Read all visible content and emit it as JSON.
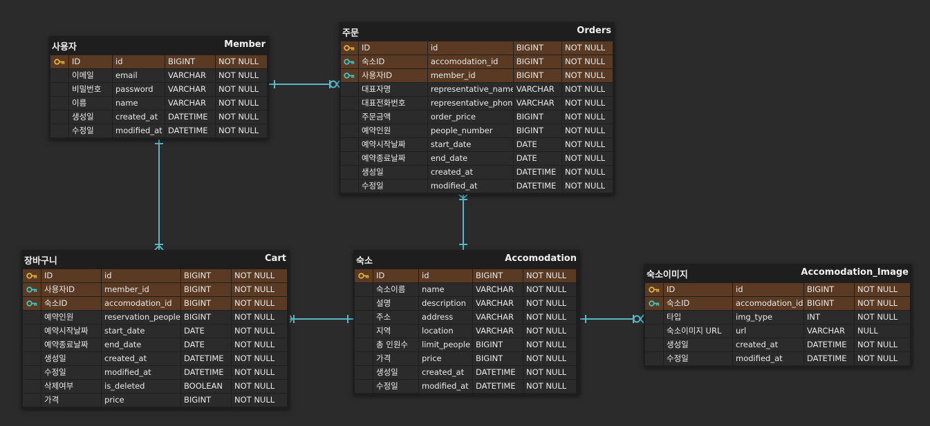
{
  "colors": {
    "background": "#2b2b2b",
    "table": "#1e1e1e",
    "cell": "#2b2b2b",
    "key_row": "#5a3a22",
    "primary_key_icon": "#e0b43c",
    "foreign_key_icon": "#3fc8c8",
    "relation_line": "#5ab8c8"
  },
  "tables": {
    "member": {
      "title_ko": "사용자",
      "title_en": "Member",
      "rows": [
        {
          "icon": "pk",
          "label": "ID",
          "name": "id",
          "type": "BIGINT",
          "constraint": "NOT NULL"
        },
        {
          "icon": "",
          "label": "이메일",
          "name": "email",
          "type": "VARCHAR",
          "constraint": "NOT NULL"
        },
        {
          "icon": "",
          "label": "비밀번호",
          "name": "password",
          "type": "VARCHAR",
          "constraint": "NOT NULL"
        },
        {
          "icon": "",
          "label": "이름",
          "name": "name",
          "type": "VARCHAR",
          "constraint": "NOT NULL"
        },
        {
          "icon": "",
          "label": "생성일",
          "name": "created_at",
          "type": "DATETIME",
          "constraint": "NOT NULL"
        },
        {
          "icon": "",
          "label": "수정일",
          "name": "modified_at",
          "type": "DATETIME",
          "constraint": "NOT NULL"
        }
      ]
    },
    "orders": {
      "title_ko": "주문",
      "title_en": "Orders",
      "rows": [
        {
          "icon": "pk",
          "label": "ID",
          "name": "id",
          "type": "BIGINT",
          "constraint": "NOT NULL"
        },
        {
          "icon": "fk",
          "label": "숙소ID",
          "name": "accomodation_id",
          "type": "BIGINT",
          "constraint": "NOT NULL"
        },
        {
          "icon": "fk",
          "label": "사용자ID",
          "name": "member_id",
          "type": "BIGINT",
          "constraint": "NOT NULL"
        },
        {
          "icon": "",
          "label": "대표자명",
          "name": "representative_name",
          "type": "VARCHAR",
          "constraint": "NOT NULL"
        },
        {
          "icon": "",
          "label": "대표전화번호",
          "name": "representative_phone",
          "type": "VARCHAR",
          "constraint": "NOT NULL"
        },
        {
          "icon": "",
          "label": "주문금액",
          "name": "order_price",
          "type": "BIGINT",
          "constraint": "NOT NULL"
        },
        {
          "icon": "",
          "label": "예약인원",
          "name": "people_number",
          "type": "BIGINT",
          "constraint": "NOT NULL"
        },
        {
          "icon": "",
          "label": "예약시작날짜",
          "name": "start_date",
          "type": "DATE",
          "constraint": "NOT NULL"
        },
        {
          "icon": "",
          "label": "예약종료날짜",
          "name": "end_date",
          "type": "DATE",
          "constraint": "NOT NULL"
        },
        {
          "icon": "",
          "label": "생성일",
          "name": "created_at",
          "type": "DATETIME",
          "constraint": "NOT NULL"
        },
        {
          "icon": "",
          "label": "수정일",
          "name": "modified_at",
          "type": "DATETIME",
          "constraint": "NOT NULL"
        }
      ]
    },
    "cart": {
      "title_ko": "장바구니",
      "title_en": "Cart",
      "rows": [
        {
          "icon": "pk",
          "label": "ID",
          "name": "id",
          "type": "BIGINT",
          "constraint": "NOT NULL"
        },
        {
          "icon": "fk",
          "label": "사용자ID",
          "name": "member_id",
          "type": "BIGINT",
          "constraint": "NOT NULL"
        },
        {
          "icon": "fk",
          "label": "숙소ID",
          "name": "accomodation_id",
          "type": "BIGINT",
          "constraint": "NOT NULL"
        },
        {
          "icon": "",
          "label": "예약인원",
          "name": "reservation_people",
          "type": "BIGINT",
          "constraint": "NOT NULL"
        },
        {
          "icon": "",
          "label": "예약시작날짜",
          "name": "start_date",
          "type": "DATE",
          "constraint": "NOT NULL"
        },
        {
          "icon": "",
          "label": "예약종료날짜",
          "name": "end_date",
          "type": "DATE",
          "constraint": "NOT NULL"
        },
        {
          "icon": "",
          "label": "생성일",
          "name": "created_at",
          "type": "DATETIME",
          "constraint": "NOT NULL"
        },
        {
          "icon": "",
          "label": "수정일",
          "name": "modified_at",
          "type": "DATETIME",
          "constraint": "NOT NULL"
        },
        {
          "icon": "",
          "label": "삭제여부",
          "name": "is_deleted",
          "type": "BOOLEAN",
          "constraint": "NOT NULL"
        },
        {
          "icon": "",
          "label": "가격",
          "name": "price",
          "type": "BIGINT",
          "constraint": "NOT NULL"
        }
      ]
    },
    "accomodation": {
      "title_ko": "숙소",
      "title_en": "Accomodation",
      "rows": [
        {
          "icon": "pk",
          "label": "ID",
          "name": "id",
          "type": "BIGINT",
          "constraint": "NOT NULL"
        },
        {
          "icon": "",
          "label": "숙소이름",
          "name": "name",
          "type": "VARCHAR",
          "constraint": "NOT NULL"
        },
        {
          "icon": "",
          "label": "설명",
          "name": "description",
          "type": "VARCHAR",
          "constraint": "NOT NULL"
        },
        {
          "icon": "",
          "label": "주소",
          "name": "address",
          "type": "VARCHAR",
          "constraint": "NOT NULL"
        },
        {
          "icon": "",
          "label": "지역",
          "name": "location",
          "type": "VARCHAR",
          "constraint": "NOT NULL"
        },
        {
          "icon": "",
          "label": "총 인원수",
          "name": "limit_people",
          "type": "BIGINT",
          "constraint": "NOT NULL"
        },
        {
          "icon": "",
          "label": "가격",
          "name": "price",
          "type": "BIGINT",
          "constraint": "NOT NULL"
        },
        {
          "icon": "",
          "label": "생성일",
          "name": "created_at",
          "type": "DATETIME",
          "constraint": "NOT NULL"
        },
        {
          "icon": "",
          "label": "수정일",
          "name": "modified_at",
          "type": "DATETIME",
          "constraint": "NOT NULL"
        }
      ]
    },
    "accomodation_image": {
      "title_ko": "숙소이미지",
      "title_en": "Accomodation_Image",
      "rows": [
        {
          "icon": "pk",
          "label": "ID",
          "name": "id",
          "type": "BIGINT",
          "constraint": "NOT NULL"
        },
        {
          "icon": "fk",
          "label": "숙소ID",
          "name": "accomodation_id",
          "type": "BIGINT",
          "constraint": "NOT NULL"
        },
        {
          "icon": "",
          "label": "타입",
          "name": "img_type",
          "type": "INT",
          "constraint": "NOT NULL"
        },
        {
          "icon": "",
          "label": "숙소이미지 URL",
          "name": "url",
          "type": "VARCHAR",
          "constraint": "NULL"
        },
        {
          "icon": "",
          "label": "생성일",
          "name": "created_at",
          "type": "DATETIME",
          "constraint": "NOT NULL"
        },
        {
          "icon": "",
          "label": "수정일",
          "name": "modified_at",
          "type": "DATETIME",
          "constraint": "NOT NULL"
        }
      ]
    }
  }
}
